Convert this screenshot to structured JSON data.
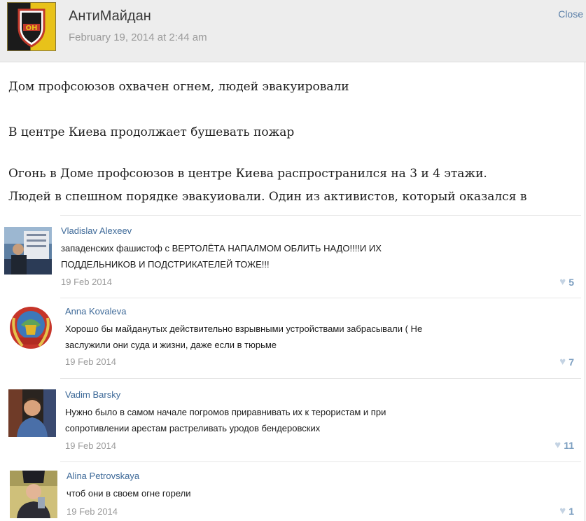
{
  "post": {
    "author": "АнтиМайдан",
    "date": "February 19, 2014 at 2:44 am",
    "close_label": "Close",
    "logo_text": "ОН",
    "paragraphs": [
      "Дом профсоюзов охвачен огнем, людей эвакуировали",
      "В центре Киева продолжает бушевать пожар",
      "Огонь в Доме профсоюзов в центре Киева распространился на 3 и 4 этажи.",
      "Людей в спешном порядке эвакуиовали. Один из активистов, который оказался в"
    ]
  },
  "comments": [
    {
      "name": "Vladislav Alexeev",
      "text_lines": [
        "западенских фашистоф с ВЕРТОЛЁТА НАПАЛМОМ ОБЛИТЬ НАДО!!!!И ИХ",
        "ПОДДЕЛЬНИКОВ И ПОДСТРИКАТЕЛЕЙ ТОЖЕ!!!"
      ],
      "date": "19 Feb 2014",
      "likes": "5",
      "avatar_icon": "ship-photo-avatar"
    },
    {
      "name": "Anna Kovaleva",
      "text_lines": [
        "Хорошо бы майданутых действительно взрывными устройствами забрасывали ( Не",
        "заслужили они суда и жизни, даже если в тюрьме"
      ],
      "date": "19 Feb 2014",
      "likes": "7",
      "avatar_icon": "soviet-emblem-avatar"
    },
    {
      "name": "Vadim Barsky",
      "text_lines": [
        "Нужно было в самом начале погромов приравнивать их к терористам и при",
        "сопротивлении арестам растреливать уродов бендеровских"
      ],
      "date": "19 Feb 2014",
      "likes": "11",
      "avatar_icon": "man-photo-avatar"
    },
    {
      "name": "Alina Petrovskaya",
      "text_lines": [
        "чтоб они в своем огне горели"
      ],
      "date": "19 Feb 2014",
      "likes": "1",
      "avatar_icon": "woman-photo-avatar"
    }
  ],
  "colors": {
    "header_bg": "#ededed",
    "name_link": "#3d6998",
    "date_gray": "#9b9b9b",
    "like_blue": "#7b9ec0"
  }
}
